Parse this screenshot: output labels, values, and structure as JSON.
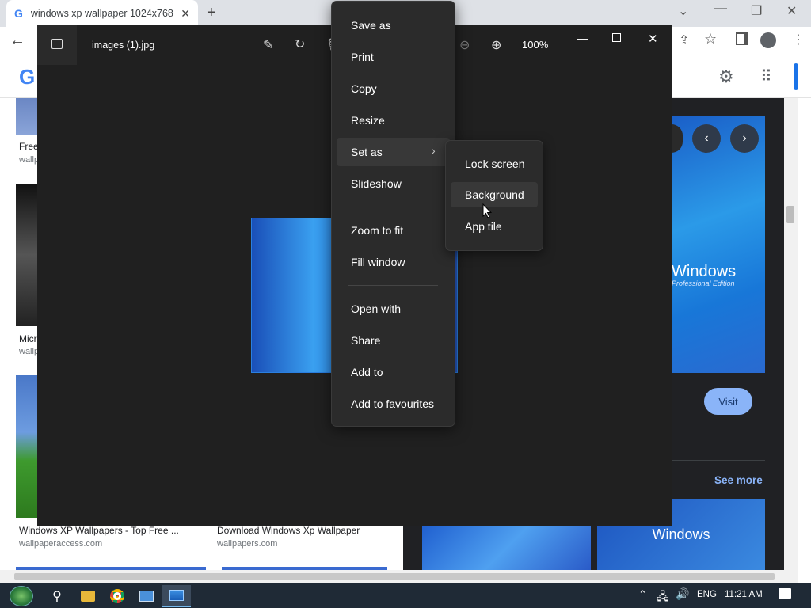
{
  "browser": {
    "tab_title": "windows xp wallpaper 1024x768",
    "tab_close": "✕",
    "new_tab": "+"
  },
  "results": {
    "left_col": [
      {
        "caption": "Free",
        "source": "wallp"
      },
      {
        "caption": "Micr",
        "source": "wallp"
      },
      {
        "caption": "Windows XP Wallpapers - Top Free ...",
        "source": "wallpaperaccess.com"
      }
    ],
    "mid_col": [
      {
        "caption": "Download Windows Xp Wallpaper",
        "source": "wallpapers.com"
      }
    ],
    "panel": {
      "visit_label": "Visit",
      "see_more_label": "See more",
      "preview_logo": "Windows",
      "preview_edition": "Professional Edition",
      "related_logo": "Windows"
    }
  },
  "viewer": {
    "filename": "images (1).jpg",
    "zoom_level": "100%"
  },
  "context_menu": {
    "items": [
      {
        "label": "Save as"
      },
      {
        "label": "Print"
      },
      {
        "label": "Copy"
      },
      {
        "label": "Resize"
      },
      {
        "label": "Set as"
      },
      {
        "label": "Slideshow"
      },
      {
        "label": "Zoom to fit"
      },
      {
        "label": "Fill window"
      },
      {
        "label": "Open with"
      },
      {
        "label": "Share"
      },
      {
        "label": "Add to"
      },
      {
        "label": "Add to favourites"
      }
    ],
    "submenu": [
      {
        "label": "Lock screen"
      },
      {
        "label": "Background"
      },
      {
        "label": "App tile"
      }
    ]
  },
  "taskbar": {
    "language": "ENG",
    "time": "11:21 AM"
  },
  "colors": {
    "chrome_tabstrip": "#dee1e6",
    "viewer_bg": "#202020",
    "menu_bg": "#2b2b2b",
    "taskbar_bg": "#1f2a36",
    "accent_blue": "#8ab4f8"
  }
}
